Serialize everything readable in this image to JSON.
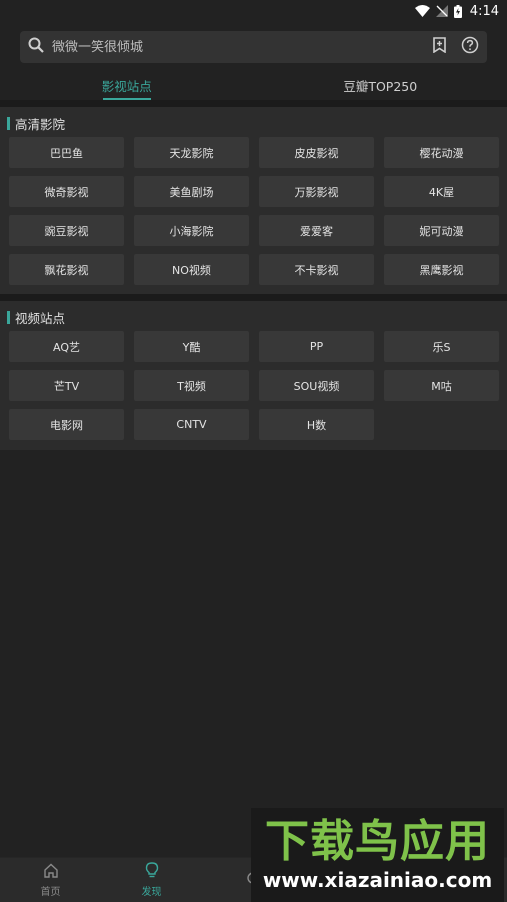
{
  "status": {
    "time": "4:14"
  },
  "search": {
    "placeholder": "微微一笑很倾城"
  },
  "tabs": [
    {
      "label": "影视站点",
      "active": true
    },
    {
      "label": "豆瓣TOP250",
      "active": false
    }
  ],
  "sections": [
    {
      "title": "高清影院",
      "items": [
        "巴巴鱼",
        "天龙影院",
        "皮皮影视",
        "樱花动漫",
        "微奇影视",
        "美鱼剧场",
        "万影影视",
        "4K屋",
        "豌豆影视",
        "小海影院",
        "爱爱客",
        "妮可动漫",
        "飘花影视",
        "NO视频",
        "不卡影视",
        "黑鹰影视"
      ]
    },
    {
      "title": "视频站点",
      "items": [
        "AQ艺",
        "Y酷",
        "PP",
        "乐S",
        "芒TV",
        "T视频",
        "SOU视频",
        "M咕",
        "电影网",
        "CNTV",
        "H数"
      ]
    }
  ],
  "bottom_nav": [
    {
      "label": "首页",
      "icon": "home-icon",
      "active": false
    },
    {
      "label": "发现",
      "icon": "lightbulb-icon",
      "active": true
    },
    {
      "label": "",
      "icon": "partial-icon",
      "active": false
    }
  ],
  "watermark": {
    "main": "下载鸟应用",
    "url": "www.xiazainiao.com"
  },
  "colors": {
    "accent": "#3aa79b",
    "background": "#222222",
    "button": "#383838"
  }
}
